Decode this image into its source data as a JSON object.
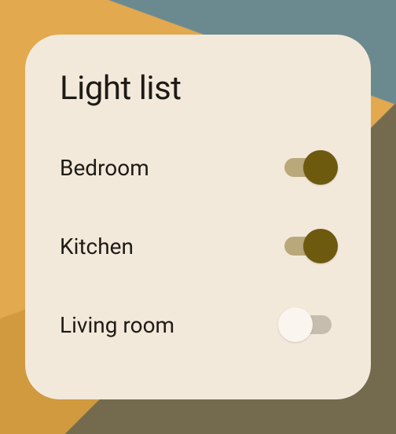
{
  "card": {
    "title": "Light list",
    "lights": [
      {
        "label": "Bedroom",
        "on": true
      },
      {
        "label": "Kitchen",
        "on": true
      },
      {
        "label": "Living room",
        "on": false
      }
    ]
  }
}
